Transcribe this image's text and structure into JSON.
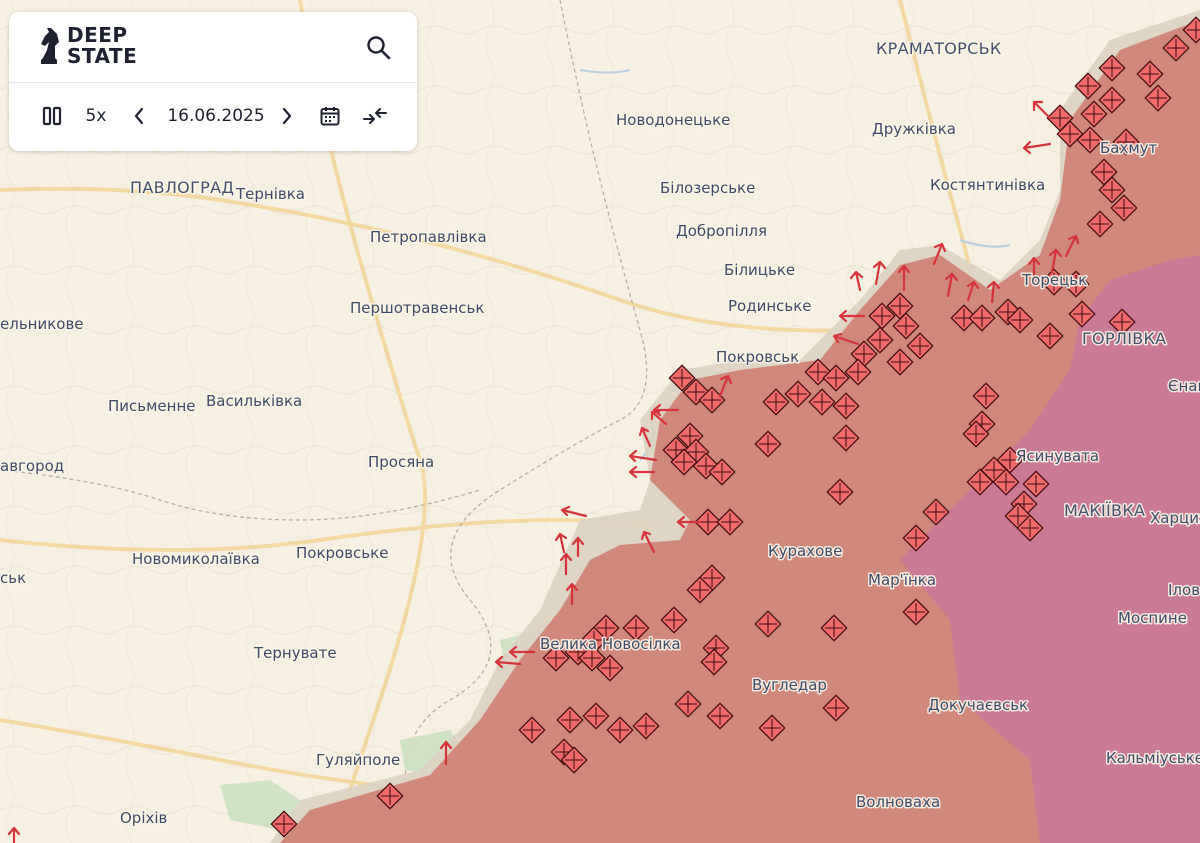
{
  "app": {
    "logo_line1": "DEEP",
    "logo_line2": "STATE",
    "date": "16.06.2025",
    "speed": "5x",
    "icons": {
      "logo": "knight-icon",
      "search": "search-icon",
      "pause": "pause-icon",
      "prev": "chevron-left-icon",
      "next": "chevron-right-icon",
      "calendar": "calendar-icon",
      "compare": "compare-arrows-icon"
    }
  },
  "colors": {
    "background": "#f6f0e2",
    "occupied": "#cd7a6c",
    "occupied_long": "#c9789a",
    "liberated": "#cfe1c3",
    "contested": "#dcd2c2",
    "marker_fill": "#f06a6a",
    "marker_stroke": "#3a0b0b",
    "label": "#3e4a66"
  },
  "map": {
    "cities": [
      {
        "name": "КРАМАТОРСЬК",
        "major": true
      },
      {
        "name": "Новодонецьке"
      },
      {
        "name": "Дружківка"
      },
      {
        "name": "ПАВЛОГРАД",
        "major": true
      },
      {
        "name": "Тернівка"
      },
      {
        "name": "Білозерське"
      },
      {
        "name": "Костянтинівка"
      },
      {
        "name": "Петропавлівка"
      },
      {
        "name": "Добропілля"
      },
      {
        "name": "Білицьке"
      },
      {
        "name": "Родинське"
      },
      {
        "name": "Першотравенськ"
      },
      {
        "name": "ельникове"
      },
      {
        "name": "Покровськ"
      },
      {
        "name": "ГОРЛІВКА",
        "major": true
      },
      {
        "name": "Письменне"
      },
      {
        "name": "Васильківка"
      },
      {
        "name": "Просяна"
      },
      {
        "name": "авгород"
      },
      {
        "name": "Ясинувата"
      },
      {
        "name": "МАКІЇВКА",
        "major": true
      },
      {
        "name": "Харцизь"
      },
      {
        "name": "Новомиколаївка"
      },
      {
        "name": "Покровське"
      },
      {
        "name": "Курахове"
      },
      {
        "name": "Мар'їнка"
      },
      {
        "name": "Тернувате"
      },
      {
        "name": "Велика Новосілка"
      },
      {
        "name": "Вугледар"
      },
      {
        "name": "Моспине"
      },
      {
        "name": "Іловайськ"
      },
      {
        "name": "Докучаєвськ"
      },
      {
        "name": "Гуляйполе"
      },
      {
        "name": "Кальміуське"
      },
      {
        "name": "Волноваха"
      },
      {
        "name": "Оріхів"
      },
      {
        "name": "Єнакієве"
      },
      {
        "name": "Бахмут"
      },
      {
        "name": "Торецьк"
      },
      {
        "name": "ськ"
      }
    ]
  }
}
